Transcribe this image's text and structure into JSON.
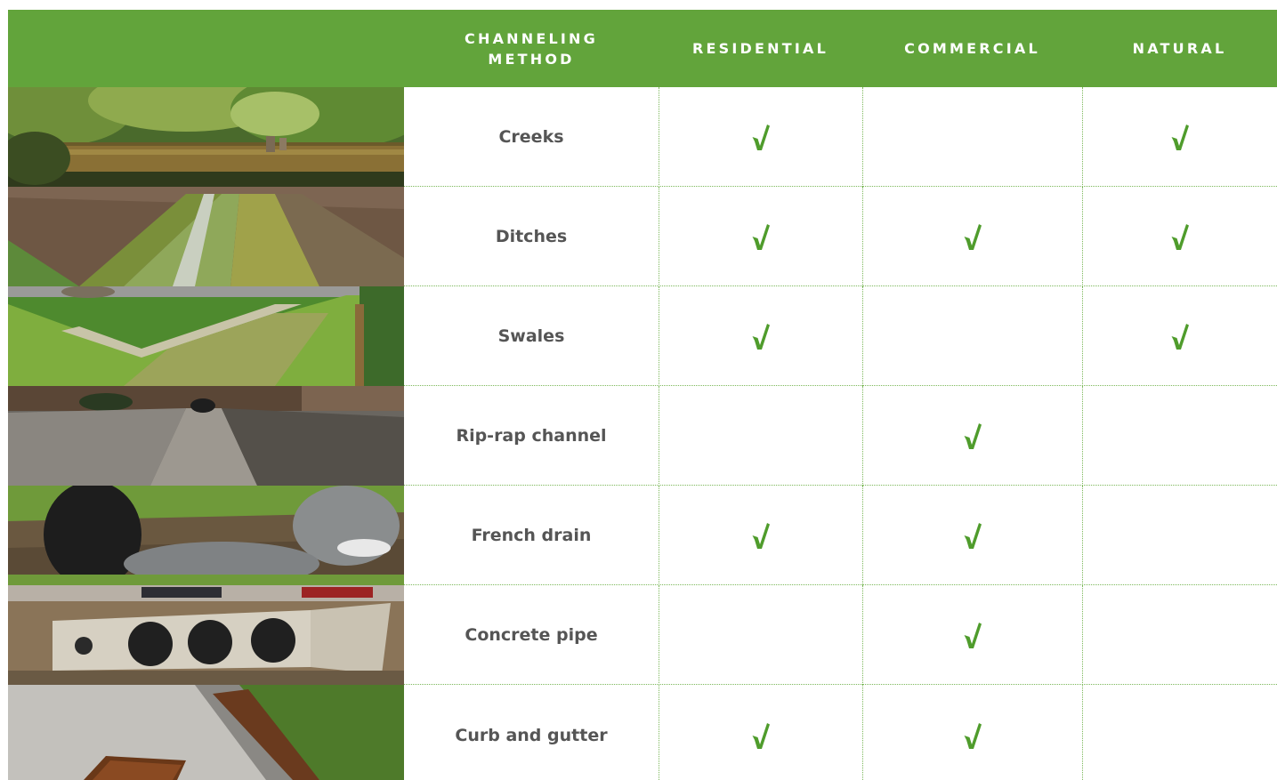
{
  "header": {
    "photo_col": "",
    "method": "CHANNELING\nMETHOD",
    "residential": "RESIDENTIAL",
    "commercial": "COMMERCIAL",
    "natural": "NATURAL"
  },
  "colors": {
    "accent": "#62a43b",
    "check": "#4f9c2c",
    "text": "#555555"
  },
  "rows": [
    {
      "method": "Creeks",
      "photo": "creek-photo",
      "residential": true,
      "commercial": false,
      "natural": true
    },
    {
      "method": "Ditches",
      "photo": "ditch-photo",
      "residential": true,
      "commercial": true,
      "natural": true
    },
    {
      "method": "Swales",
      "photo": "swale-photo",
      "residential": true,
      "commercial": false,
      "natural": true
    },
    {
      "method": "Rip-rap channel",
      "photo": "rip-rap-channel-photo",
      "residential": false,
      "commercial": true,
      "natural": false
    },
    {
      "method": "French drain",
      "photo": "french-drain-photo",
      "residential": true,
      "commercial": true,
      "natural": false
    },
    {
      "method": "Concrete pipe",
      "photo": "concrete-pipe-photo",
      "residential": false,
      "commercial": true,
      "natural": false
    },
    {
      "method": "Curb and gutter",
      "photo": "curb-and-gutter-photo",
      "residential": true,
      "commercial": true,
      "natural": false
    }
  ]
}
